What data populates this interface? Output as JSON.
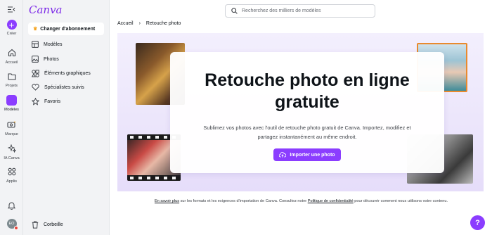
{
  "rail": {
    "create": "Créer",
    "home": "Accueil",
    "projects": "Projets",
    "templates": "Modèles",
    "brand": "Marque",
    "ai": "IA Canva",
    "apps": "Applis",
    "avatar_initials": "EO"
  },
  "panel": {
    "logo": "Canva",
    "upgrade": "Changer d'abonnement",
    "items": [
      {
        "label": "Modèles",
        "icon": "templates-icon"
      },
      {
        "label": "Photos",
        "icon": "photos-icon"
      },
      {
        "label": "Éléments graphiques",
        "icon": "elements-icon"
      },
      {
        "label": "Spécialistes suivis",
        "icon": "heart-icon"
      },
      {
        "label": "Favoris",
        "icon": "star-icon"
      }
    ],
    "trash": "Corbeille"
  },
  "search": {
    "placeholder": "Recherchez des milliers de modèles"
  },
  "breadcrumb": {
    "home": "Accueil",
    "current": "Retouche photo"
  },
  "hero": {
    "title_line1": "Retouche photo en ligne",
    "title_line2": "gratuite",
    "description_line1": "Sublimez vos photos avec l'outil de retouche photo gratuit de Canva. Importez, modifiez et",
    "description_line2": "partagez instantanément au même endroit.",
    "cta": "Importer une photo"
  },
  "footer": {
    "link1": "En savoir plus",
    "text1": " sur les formats et les exigences d'importation de Canva. Consultez notre ",
    "link2": "Politique de confidentialité",
    "text2": " pour découvrir comment nous utilisons votre contenu."
  },
  "help": "?",
  "colors": {
    "accent": "#8b3dff",
    "logo": "#7d2ae8",
    "hero_bg": "#ece6fb"
  }
}
